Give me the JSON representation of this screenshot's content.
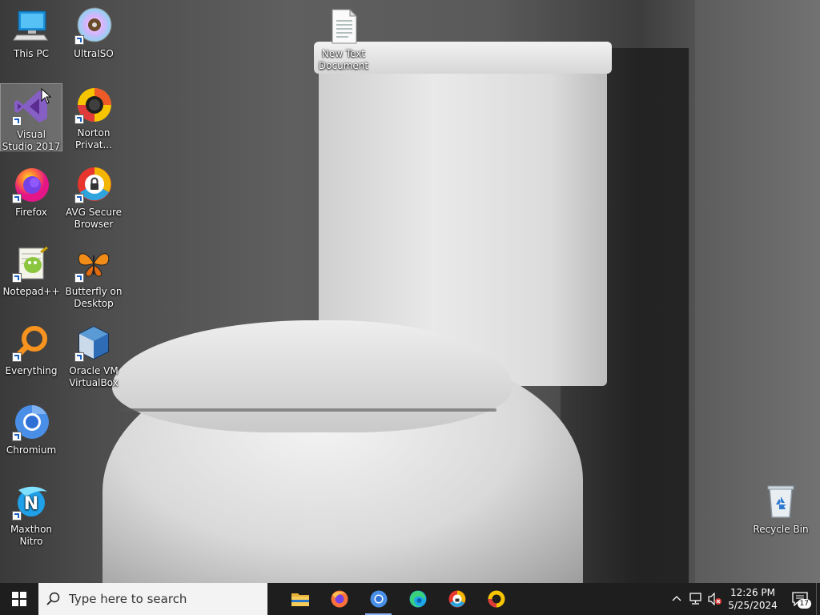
{
  "desktop": {
    "icons": [
      {
        "label": "This PC",
        "icon": "computer-icon",
        "shortcut": false
      },
      {
        "label": "UltraISO",
        "icon": "disc-icon",
        "shortcut": true
      },
      {
        "label": "New Text Document",
        "icon": "text-file-icon",
        "shortcut": false
      },
      {
        "label": "Visual Studio 2017",
        "icon": "visual-studio-icon",
        "shortcut": true,
        "selected": true
      },
      {
        "label": "Norton Privat...",
        "icon": "norton-browser-icon",
        "shortcut": true
      },
      {
        "label": "Firefox",
        "icon": "firefox-icon",
        "shortcut": true
      },
      {
        "label": "AVG Secure Browser",
        "icon": "avg-browser-icon",
        "shortcut": true
      },
      {
        "label": "Notepad++",
        "icon": "notepadpp-icon",
        "shortcut": true
      },
      {
        "label": "Butterfly on Desktop",
        "icon": "butterfly-icon",
        "shortcut": true
      },
      {
        "label": "Everything",
        "icon": "everything-search-icon",
        "shortcut": true
      },
      {
        "label": "Oracle VM VirtualBox",
        "icon": "virtualbox-icon",
        "shortcut": true
      },
      {
        "label": "Chromium",
        "icon": "chromium-icon",
        "shortcut": true
      },
      {
        "label": "Maxthon Nitro",
        "icon": "maxthon-icon",
        "shortcut": true
      },
      {
        "label": "Recycle Bin",
        "icon": "recycle-bin-icon",
        "shortcut": false
      }
    ]
  },
  "taskbar": {
    "search_placeholder": "Type here to search",
    "pinned": [
      {
        "name": "File Explorer",
        "icon": "folder-icon"
      },
      {
        "name": "Firefox",
        "icon": "firefox-icon"
      },
      {
        "name": "Chromium",
        "icon": "chromium-icon",
        "active": true
      },
      {
        "name": "Microsoft Edge",
        "icon": "edge-icon"
      },
      {
        "name": "AVG Secure Browser",
        "icon": "avg-browser-icon"
      },
      {
        "name": "Norton Private Browser",
        "icon": "norton-browser-icon"
      }
    ],
    "clock": {
      "time": "12:26 PM",
      "date": "5/25/2024"
    },
    "notification_count": "17"
  },
  "colors": {
    "taskbar_bg": "#1e1e1e",
    "search_bg": "#f3f3f3",
    "accent": "#1a5fc0"
  }
}
